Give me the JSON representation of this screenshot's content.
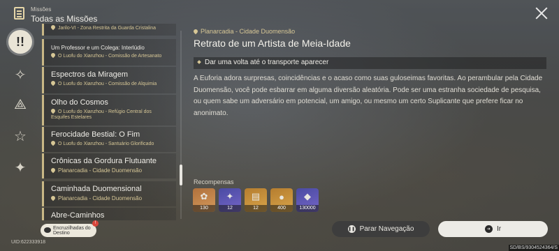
{
  "header": {
    "section": "Missões",
    "title": "Todas as Missões"
  },
  "missions": [
    {
      "name": "",
      "location": "Jarilo-VI - Zona Restrita da Guarda Cristalina"
    },
    {
      "name": "Um Professor e um Colega: Interlúdio",
      "location": "O Luofu do Xianzhou - Comissão de Artesanato"
    },
    {
      "name": "Espectros da Miragem",
      "location": "O Luofu do Xianzhou - Comissão de Alquimia"
    },
    {
      "name": "Olho do Cosmos",
      "location": "O Luofu do Xianzhou - Refúgio Central dos Esquifes Estelares"
    },
    {
      "name": "Ferocidade Bestial: O Fim",
      "location": "O Luofu do Xianzhou - Santuário Glorificado"
    },
    {
      "name": "Crônicas da Gordura Flutuante",
      "location": "Planarcadia - Cidade Duomensão"
    },
    {
      "name": "Caminhada Duomensional",
      "location": "Planarcadia - Cidade Duomensão"
    },
    {
      "name": "Abre-Caminhos",
      "location": ""
    }
  ],
  "destiny_button": {
    "label": "Encruzilhadas do Destino",
    "badge": "!"
  },
  "uid": "UID:622333918",
  "version": "SD/BS/9304524364/S",
  "detail": {
    "region": "Planarcadia - Cidade Duomensão",
    "title": "Retrato de um Artista de Meia-Idade",
    "objective": "Dar uma volta até o transporte aparecer",
    "description": "A Euforia adora surpresas, coincidências e o acaso como suas guloseimas favoritas. Ao perambular pela Cidade Duomensão, você pode esbarrar em alguma diversão aleatória. Pode ser uma estranha sociedade de pesquisa, ou quem sabe um adversário em potencial, um amigo, ou mesmo um certo Suplicante que prefere ficar no anonimato."
  },
  "rewards": {
    "label": "Recompensas",
    "items": [
      {
        "icon": "exp-material-icon",
        "qty": "130",
        "color": "#c2844a"
      },
      {
        "icon": "star-rail-pass-icon",
        "qty": "12",
        "color": "#5e58b5"
      },
      {
        "icon": "traveler-guide-icon",
        "qty": "12",
        "color": "#c99240"
      },
      {
        "icon": "credit-coin-icon",
        "qty": "400",
        "color": "#c99240"
      },
      {
        "icon": "character-exp-icon",
        "qty": "130000",
        "color": "#5e58b5"
      }
    ]
  },
  "buttons": {
    "pause_nav": "Parar Navegação",
    "go": "Ir"
  }
}
